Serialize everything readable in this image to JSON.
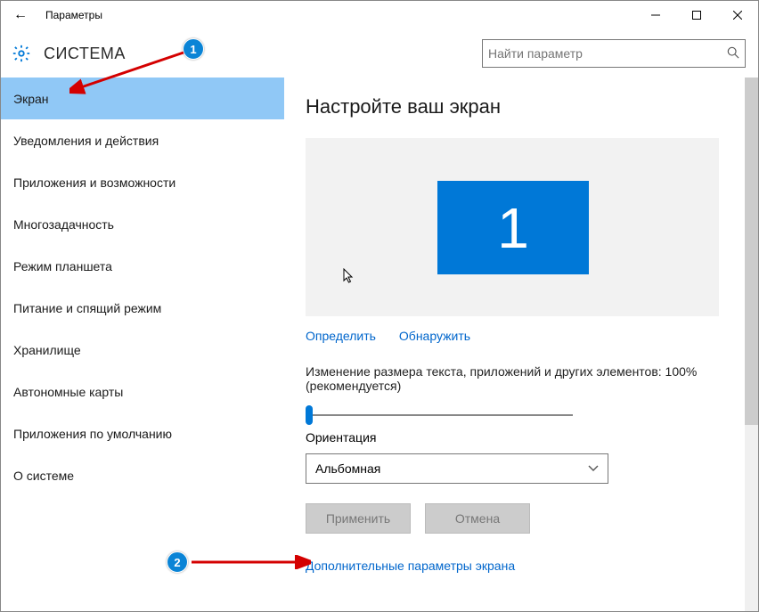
{
  "window": {
    "title": "Параметры",
    "back_icon": "←"
  },
  "header": {
    "title": "СИСТЕМА",
    "search_placeholder": "Найти параметр"
  },
  "sidebar": {
    "items": [
      {
        "label": "Экран",
        "selected": true
      },
      {
        "label": "Уведомления и действия"
      },
      {
        "label": "Приложения и возможности"
      },
      {
        "label": "Многозадачность"
      },
      {
        "label": "Режим планшета"
      },
      {
        "label": "Питание и спящий режим"
      },
      {
        "label": "Хранилище"
      },
      {
        "label": "Автономные карты"
      },
      {
        "label": "Приложения по умолчанию"
      },
      {
        "label": "О системе"
      }
    ]
  },
  "main": {
    "heading": "Настройте ваш экран",
    "monitor_number": "1",
    "identify_link": "Определить",
    "detect_link": "Обнаружить",
    "scale_label": "Изменение размера текста, приложений и других элементов: 100% (рекомендуется)",
    "orientation_label": "Ориентация",
    "orientation_value": "Альбомная",
    "apply_btn": "Применить",
    "cancel_btn": "Отмена",
    "advanced_link": "Дополнительные параметры экрана"
  },
  "annotations": {
    "badge1": "1",
    "badge2": "2"
  }
}
